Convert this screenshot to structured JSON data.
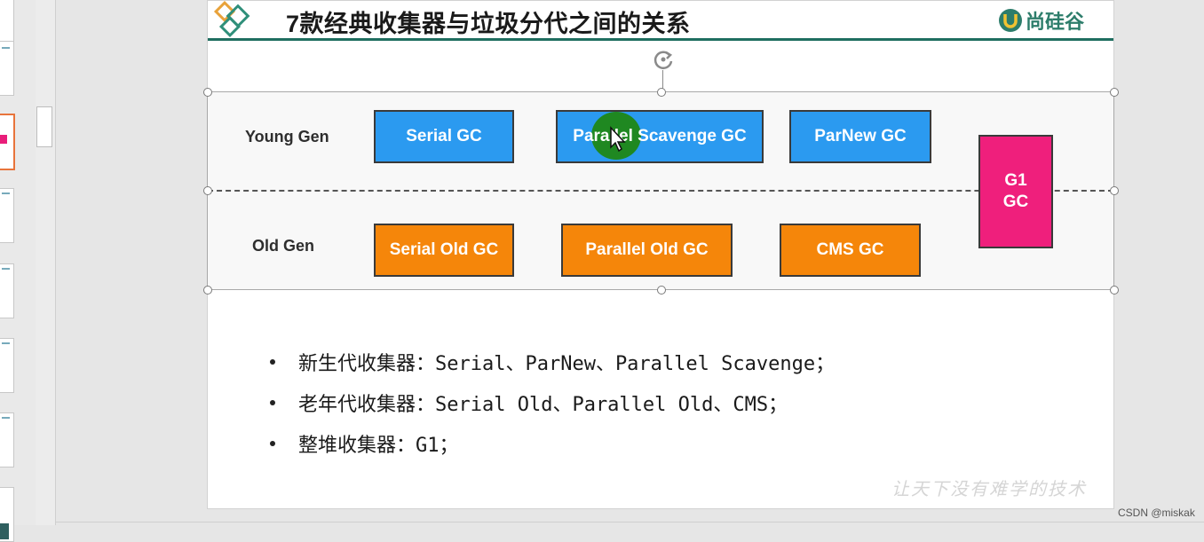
{
  "slide": {
    "title": "7款经典收集器与垃圾分代之间的关系",
    "brand_name": "尚硅谷",
    "motto": "让天下没有难学的技术"
  },
  "diagram": {
    "young_gen_label": "Young Gen",
    "old_gen_label": "Old Gen",
    "young_collectors": [
      "Serial GC",
      "Parallel Scavenge GC",
      "ParNew GC"
    ],
    "old_collectors": [
      "Serial Old GC",
      "Parallel Old GC",
      "CMS GC"
    ],
    "g1_lines": [
      "G1",
      "GC"
    ]
  },
  "bullets": [
    "新生代收集器：Serial、ParNew、Parallel Scavenge；",
    "老年代收集器：Serial Old、Parallel Old、CMS；",
    "整堆收集器：G1；"
  ],
  "watermark": "CSDN @miskak",
  "colors": {
    "young_box": "#2b9af0",
    "old_box": "#f5860a",
    "g1_box": "#ef1f7c",
    "accent_rule": "#1f6e60",
    "brand": "#2d7d6b"
  },
  "icons": [
    "diamond-logo-icon",
    "brand-u-icon",
    "rotate-icon",
    "cursor-icon"
  ]
}
